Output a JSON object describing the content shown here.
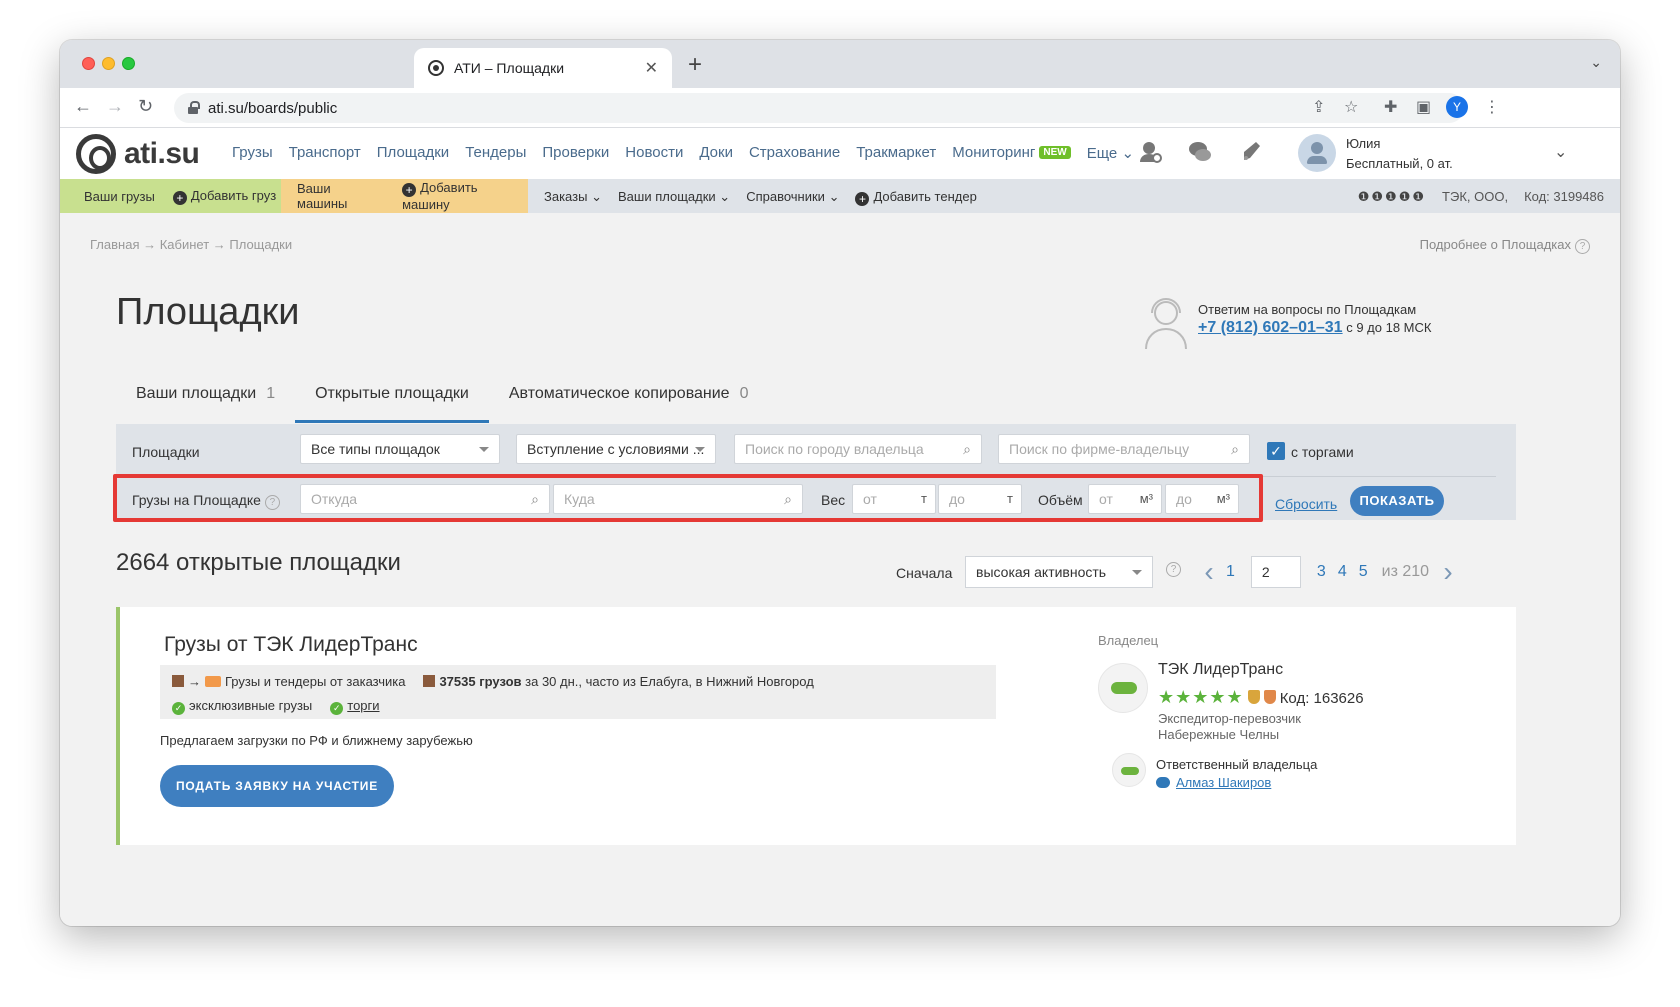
{
  "browser": {
    "tab_title": "АТИ – Площадки",
    "tab_close": "✕",
    "new_tab": "+",
    "url": "ati.su/boards/public",
    "profile_letter": "Y",
    "tabstrip_menu": "⌄"
  },
  "header": {
    "logo_text": "ati.su",
    "nav": [
      "Грузы",
      "Транспорт",
      "Площадки",
      "Тендеры",
      "Проверки",
      "Новости",
      "Доки",
      "Страхование",
      "Тракмаркет",
      "Мониторинг"
    ],
    "new_badge": "NEW",
    "more": "Еще",
    "user_name": "Юлия",
    "user_plan": "Бесплатный,   0 ат."
  },
  "subbar": {
    "your_cargo": "Ваши грузы",
    "add_cargo": "Добавить груз",
    "your_trucks": "Ваши машины",
    "add_truck": "Добавить машину",
    "orders": "Заказы",
    "your_boards": "Ваши площадки",
    "references": "Справочники",
    "add_tender": "Добавить тендер",
    "rating": "❶❶❶❶❶",
    "company": "ТЭК, ООО,",
    "code": "Код: 3199486"
  },
  "page": {
    "breadcrumb": "Главная → Кабинет → Площадки",
    "more_link": "Подробнее о Площадках",
    "title": "Площадки",
    "support_line1": "Ответим на вопросы по Площадкам",
    "support_phone": "+7 (812) 602–01–31",
    "support_hours": "с 9 до 18 МСК"
  },
  "tabs": [
    {
      "label": "Ваши площадки",
      "count": "1"
    },
    {
      "label": "Открытые площадки",
      "count": ""
    },
    {
      "label": "Автоматическое копирование",
      "count": "0"
    }
  ],
  "filters": {
    "boards_label": "Площадки",
    "type_select": "Все типы площадок",
    "join_select": "Вступление с условиями ...",
    "city_placeholder": "Поиск по городу владельца",
    "firm_placeholder": "Поиск по фирме-владельцу",
    "tenders_label": "с торгами",
    "cargo_label": "Грузы на Площадке",
    "from_placeholder": "Откуда",
    "to_placeholder": "Куда",
    "weight_label": "Вес",
    "weight_from": "от",
    "weight_to": "до",
    "weight_unit": "т",
    "volume_label": "Объём",
    "volume_from": "от",
    "volume_to": "до",
    "volume_unit": "м³",
    "reset": "Сбросить",
    "show": "ПОКАЗАТЬ"
  },
  "results": {
    "count_title": "2664 открытые площадки",
    "sort_label": "Сначала",
    "sort_value": "высокая активность",
    "pages": [
      "1",
      "3",
      "4",
      "5"
    ],
    "current_page": "2",
    "of_pages": "из 210"
  },
  "card": {
    "title": "Грузы от ТЭК ЛидерТранс",
    "info_customer": "Грузы и тендеры от заказчика",
    "info_count": "37535 грузов",
    "info_count_rest": "за 30 дн., часто из Елабуга, в Нижний Новгород",
    "exclusive": "эксклюзивные грузы",
    "auctions": "торги",
    "description": "Предлагаем загрузки по РФ и ближнему зарубежью",
    "apply": "ПОДАТЬ ЗАЯВКУ НА УЧАСТИЕ",
    "owner_label": "Владелец",
    "owner_name": "ТЭК ЛидерТранс",
    "owner_stars": "★★★★★",
    "owner_code": "Код: 163626",
    "owner_type": "Экспедитор-перевозчик",
    "owner_city": "Набережные Челны",
    "resp_label": "Ответственный владельца",
    "resp_name": "Алмаз Шакиров"
  }
}
